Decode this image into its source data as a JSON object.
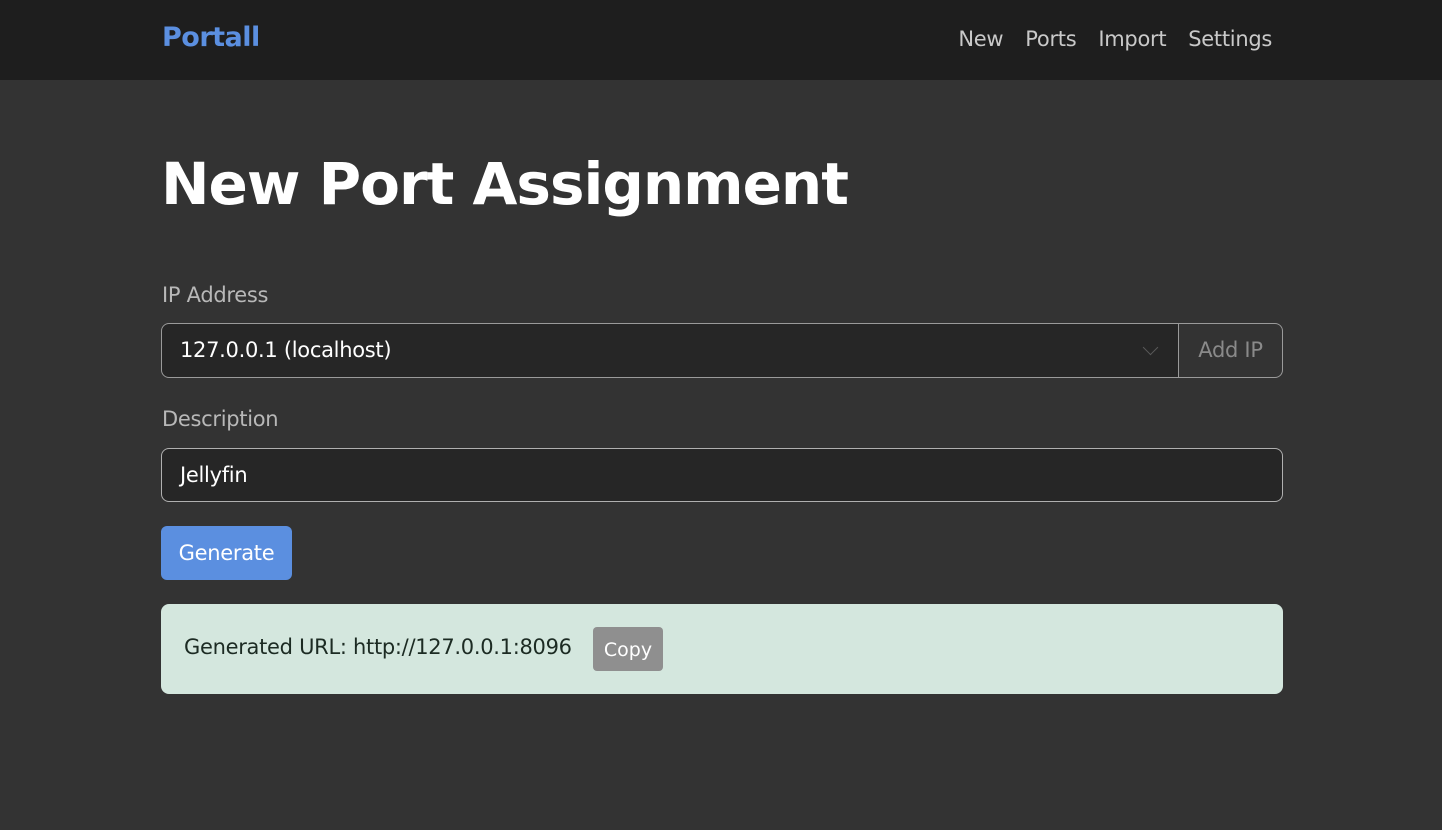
{
  "nav": {
    "brand": "Portall",
    "links": [
      "New",
      "Ports",
      "Import",
      "Settings"
    ]
  },
  "page": {
    "title": "New Port Assignment"
  },
  "form": {
    "ip_label": "IP Address",
    "ip_selected": "127.0.0.1 (localhost)",
    "add_ip_label": "Add IP",
    "description_label": "Description",
    "description_value": "Jellyfin",
    "generate_label": "Generate"
  },
  "result": {
    "text": "Generated URL: http://127.0.0.1:8096",
    "copy_label": "Copy"
  },
  "colors": {
    "accent": "#5b8fe0",
    "background": "#333333",
    "navbar": "#1e1e1e",
    "success_bg": "#d4e7de"
  },
  "icons": {
    "select_chevron": "chevron-down-icon"
  }
}
